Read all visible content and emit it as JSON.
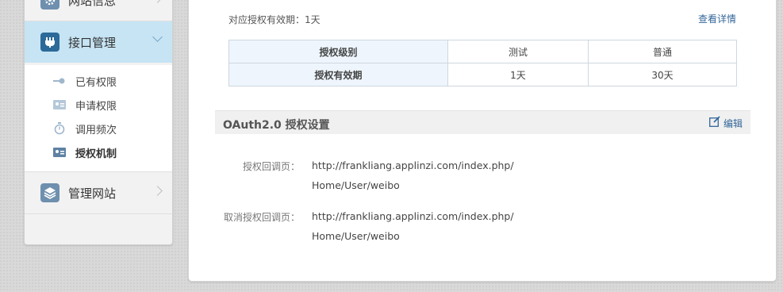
{
  "sidebar": {
    "top_item": {
      "label": "网站信息",
      "icon": "gear-icon"
    },
    "active_item": {
      "label": "接口管理",
      "icon": "plug-icon"
    },
    "sub_items": [
      {
        "label": "已有权限",
        "icon": "key-icon"
      },
      {
        "label": "申请权限",
        "icon": "id-card-icon"
      },
      {
        "label": "调用频次",
        "icon": "stopwatch-icon"
      },
      {
        "label": "授权机制",
        "icon": "id-card-icon"
      }
    ],
    "bottom_item": {
      "label": "管理网站",
      "icon": "layers-icon"
    }
  },
  "main": {
    "validity_text": "对应授权有效期：1天",
    "view_details_link": "查看详情",
    "auth_table": {
      "rows": [
        {
          "header": "授权级别",
          "cells": [
            "测试",
            "普通"
          ]
        },
        {
          "header": "授权有效期",
          "cells": [
            "1天",
            "30天"
          ]
        }
      ]
    },
    "oauth_section": {
      "title": "OAuth2.0 授权设置",
      "edit_label": "编辑",
      "fields": [
        {
          "label": "授权回调页：",
          "value": "http://frankliang.applinzi.com/index.php/Home/User/weibo"
        },
        {
          "label": "取消授权回调页：",
          "value": "http://frankliang.applinzi.com/index.php/Home/User/weibo"
        }
      ]
    }
  },
  "colors": {
    "active_nav_bg": "#c6e4f4",
    "link": "#336699",
    "table_header_bg": "#eef5fc"
  }
}
